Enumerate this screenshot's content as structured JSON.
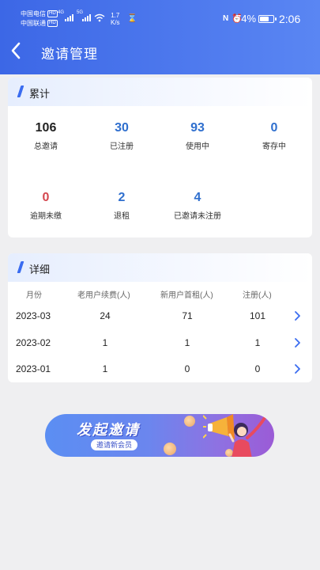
{
  "status_bar": {
    "carrier_1": "中国电信",
    "carrier_2": "中国联通",
    "hd": "HD",
    "network_1": "4G",
    "network_2": "5G",
    "speed_value": "1.7",
    "speed_unit": "K/s",
    "battery": "74%",
    "battery_level": 0.74,
    "time": "2:06"
  },
  "header": {
    "title": "邀请管理"
  },
  "summary": {
    "title": "累计",
    "stats": [
      {
        "value": "106",
        "label": "总邀请",
        "color": "#222222"
      },
      {
        "value": "30",
        "label": "已注册",
        "color": "#2f6fce"
      },
      {
        "value": "93",
        "label": "使用中",
        "color": "#2f6fce"
      },
      {
        "value": "0",
        "label": "寄存中",
        "color": "#2f6fce"
      },
      {
        "value": "0",
        "label": "逾期未缴",
        "color": "#d4474f"
      },
      {
        "value": "2",
        "label": "退租",
        "color": "#2f6fce"
      },
      {
        "value": "4",
        "label": "已邀请未注册",
        "color": "#2f6fce"
      }
    ]
  },
  "details": {
    "title": "详细",
    "columns": [
      "月份",
      "老用户续费(人)",
      "新用户首租(人)",
      "注册(人)"
    ],
    "rows": [
      {
        "month": "2023-03",
        "renew": "24",
        "first_rent": "71",
        "register": "101"
      },
      {
        "month": "2023-02",
        "renew": "1",
        "first_rent": "1",
        "register": "1"
      },
      {
        "month": "2023-01",
        "renew": "1",
        "first_rent": "0",
        "register": "0"
      }
    ]
  },
  "banner": {
    "slogan": "发起邀请",
    "subtitle": "邀请新会员"
  },
  "colors": {
    "accent": "#3c67e6",
    "number_blue": "#2f6fce",
    "number_red": "#d4474f",
    "background": "#efeff1"
  }
}
